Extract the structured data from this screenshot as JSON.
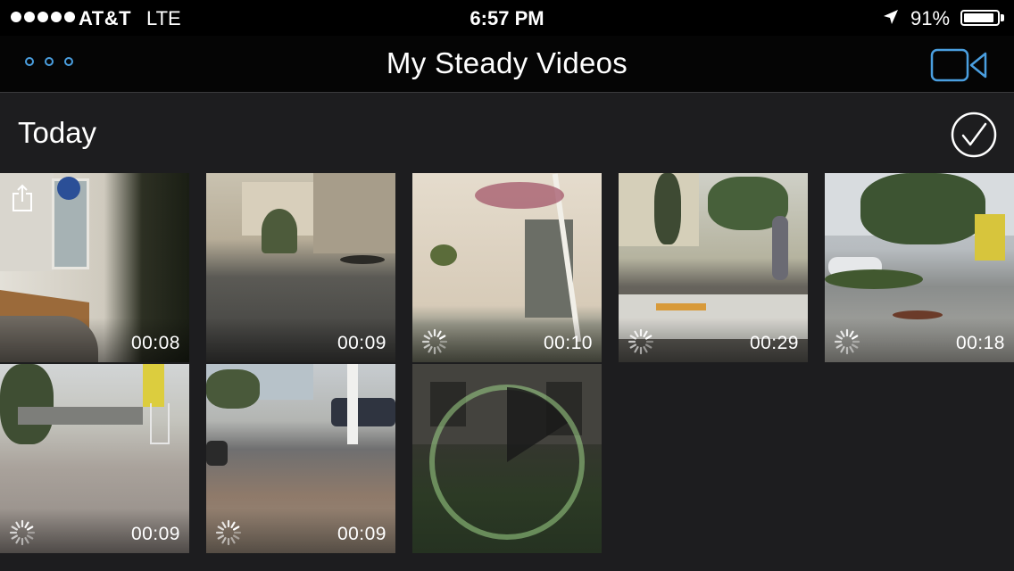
{
  "status_bar": {
    "carrier": "AT&T",
    "network": "LTE",
    "time": "6:57 PM",
    "battery_percent": "91%",
    "battery_level": 0.91,
    "signal_bars": 5,
    "location_icon": "location-arrow-icon"
  },
  "nav": {
    "title": "My Steady Videos",
    "more_icon": "more-dots-icon",
    "camera_icon": "video-camera-icon",
    "accent_color": "#4a9fe0"
  },
  "section": {
    "title": "Today",
    "select_icon": "checkmark-circle-icon"
  },
  "videos": [
    {
      "duration": "00:08",
      "processing": false,
      "shared": true
    },
    {
      "duration": "00:09",
      "processing": false,
      "shared": false
    },
    {
      "duration": "00:10",
      "processing": true,
      "shared": false
    },
    {
      "duration": "00:29",
      "processing": true,
      "shared": false
    },
    {
      "duration": "00:18",
      "processing": true,
      "shared": false
    },
    {
      "duration": "00:09",
      "processing": true,
      "shared": false
    },
    {
      "duration": "00:09",
      "processing": true,
      "shared": false
    },
    {
      "duration": "",
      "processing": true,
      "shared": false,
      "progress": 0.92
    }
  ]
}
